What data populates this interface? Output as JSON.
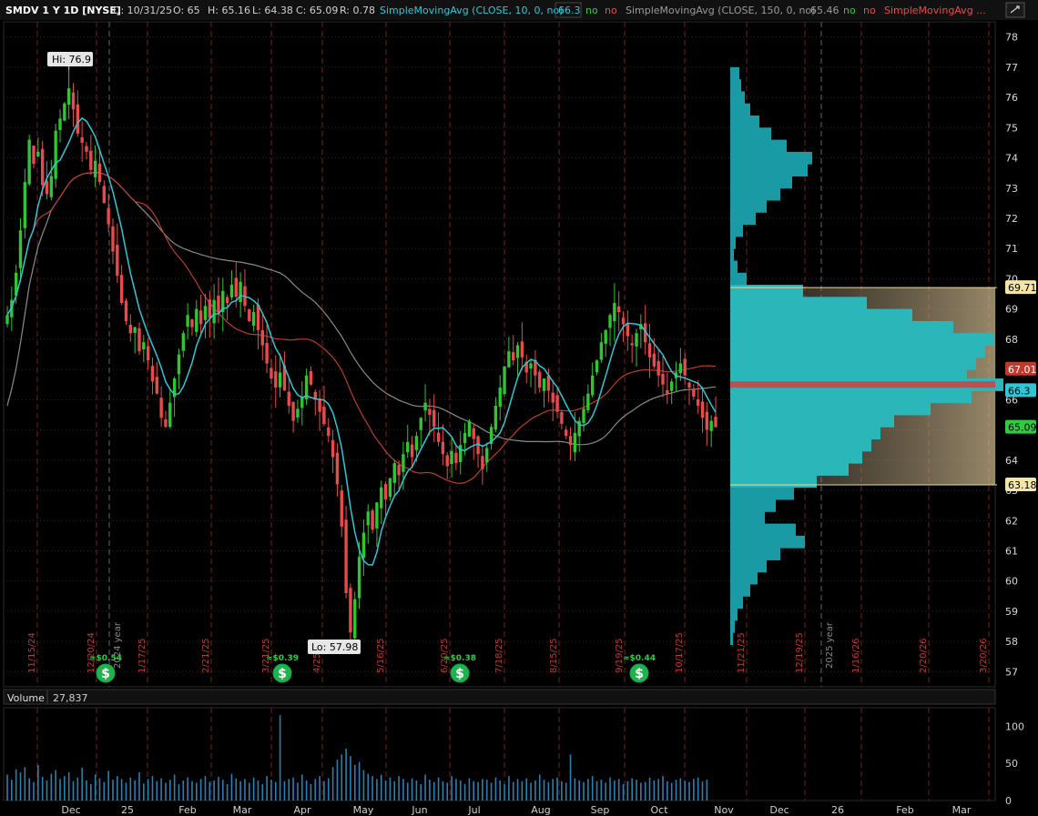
{
  "header": {
    "symbol": "SMDV 1 Y 1D [NYSE]",
    "date": "D: 10/31/25",
    "open": "O: 65",
    "high": "H: 65.16",
    "low": "L: 64.38",
    "close": "C: 65.09",
    "range": "R: 0.78",
    "sma1_label": "SimpleMovingAvg (CLOSE, 10, 0, no)",
    "sma1_value": "66.3",
    "sma1_no1": "no",
    "sma1_no2": "no",
    "sma2_label": "SimpleMovingAvg (CLOSE, 150, 0, no)",
    "sma2_value": "65.46",
    "sma2_no1": "no",
    "sma2_no2": "no",
    "sma3_label": "SimpleMovingAvg ...",
    "settings_icon": "settings-icon"
  },
  "volume_panel": {
    "label": "Volume",
    "value": "27,837"
  },
  "annotations": {
    "hi": "Hi: 76.9",
    "lo": "Lo: 57.98"
  },
  "price_flags": {
    "vp_high": "69.71",
    "sma_red": "67.01",
    "sma_cyan": "66.3",
    "last": "65.09",
    "vp_low": "63.18"
  },
  "dividends": [
    "$0.54",
    "$0.39",
    "$0.38",
    "$0.44"
  ],
  "period_dates": [
    "11/15/24",
    "12/20/24",
    "1/17/25",
    "2/21/25",
    "3/21/25",
    "4/25",
    "5/16/25",
    "6/20/25",
    "7/18/25",
    "8/15/25",
    "9/19/25",
    "10/17/25",
    "11/21/25",
    "12/19/25",
    "1/16/26",
    "2/20/26",
    "3/20/26"
  ],
  "year_markers": [
    "2024 year",
    "2025 year"
  ],
  "colors": {
    "up": "#2fc62f",
    "down": "#e84b4b",
    "sma10": "#2ec7d8",
    "sma_red": "#c0392b",
    "sma150": "#8a8a8a",
    "profile": "#1aa6b0",
    "value_area": "#8a7a62"
  },
  "chart_data": {
    "type": "candlestick",
    "ylim": [
      56.5,
      78.5
    ],
    "yticks": [
      57,
      58,
      59,
      60,
      61,
      62,
      63,
      64,
      65,
      66,
      67,
      68,
      69,
      70,
      71,
      72,
      73,
      74,
      75,
      76,
      77,
      78
    ],
    "x_month_labels": [
      "Dec",
      "25",
      "Feb",
      "Mar",
      "Apr",
      "May",
      "Jun",
      "Jul",
      "Aug",
      "Sep",
      "Oct",
      "Nov",
      "Dec",
      "26",
      "Feb",
      "Mar"
    ],
    "volume_yticks": [
      0,
      50,
      100
    ],
    "volume_ylim": [
      0,
      125
    ],
    "closes": [
      68.8,
      69.3,
      70.2,
      71.6,
      73.2,
      74.6,
      73.8,
      74.2,
      73.1,
      72.8,
      73.4,
      74.9,
      75.3,
      75.8,
      76.3,
      75.6,
      74.8,
      74.5,
      74.2,
      73.6,
      73.9,
      73.2,
      72.5,
      71.8,
      70.9,
      70.1,
      69.2,
      68.6,
      68.2,
      68.4,
      67.6,
      67.9,
      67.3,
      66.6,
      66.2,
      65.4,
      65.1,
      65.9,
      66.7,
      67.5,
      68.2,
      68.8,
      68.4,
      69.0,
      68.5,
      69.1,
      68.7,
      69.3,
      68.9,
      69.6,
      69.2,
      69.8,
      69.4,
      69.9,
      69.1,
      68.6,
      68.9,
      68.3,
      67.8,
      67.2,
      66.7,
      66.4,
      66.9,
      66.3,
      65.8,
      65.3,
      65.7,
      66.1,
      66.8,
      66.5,
      66.0,
      65.6,
      65.2,
      64.8,
      64.1,
      63.2,
      61.8,
      59.6,
      58.3,
      59.4,
      60.8,
      61.6,
      62.3,
      61.7,
      62.6,
      63.1,
      62.7,
      63.4,
      63.9,
      63.5,
      64.2,
      64.6,
      64.1,
      64.8,
      65.4,
      65.9,
      65.5,
      65.1,
      64.6,
      64.2,
      63.8,
      64.3,
      63.9,
      64.5,
      64.9,
      65.3,
      64.7,
      64.2,
      63.7,
      64.4,
      65.1,
      65.8,
      66.4,
      67.1,
      67.6,
      67.3,
      67.8,
      67.4,
      66.9,
      67.2,
      66.8,
      66.4,
      66.7,
      66.3,
      65.9,
      65.6,
      65.2,
      64.8,
      64.5,
      64.9,
      65.3,
      65.7,
      66.2,
      66.8,
      67.3,
      67.9,
      68.3,
      68.8,
      69.2,
      68.9,
      68.5,
      68.1,
      67.8,
      68.2,
      68.5,
      67.9,
      67.4,
      67.1,
      66.8,
      66.5,
      66.2,
      66.6,
      66.9,
      67.2,
      66.8,
      66.4,
      66.1,
      65.8,
      65.4,
      65.0,
      65.3,
      65.09
    ],
    "volumes": [
      35,
      28,
      42,
      38,
      45,
      30,
      25,
      48,
      32,
      27,
      36,
      41,
      29,
      33,
      38,
      26,
      31,
      44,
      27,
      22,
      35,
      30,
      25,
      40,
      28,
      33,
      29,
      24,
      31,
      27,
      38,
      23,
      29,
      33,
      26,
      30,
      24,
      28,
      35,
      22,
      27,
      31,
      26,
      24,
      29,
      33,
      25,
      27,
      32,
      28,
      22,
      36,
      30,
      26,
      29,
      24,
      31,
      27,
      22,
      33,
      28,
      25,
      115,
      26,
      29,
      31,
      24,
      35,
      27,
      22,
      29,
      33,
      26,
      30,
      45,
      55,
      62,
      70,
      60,
      48,
      52,
      41,
      36,
      33,
      29,
      35,
      27,
      31,
      26,
      33,
      29,
      24,
      30,
      27,
      22,
      35,
      28,
      25,
      31,
      26,
      24,
      33,
      29,
      27,
      22,
      30,
      26,
      25,
      29,
      28,
      24,
      31,
      27,
      22,
      33,
      25,
      29,
      26,
      30,
      24,
      27,
      35,
      28,
      25,
      29,
      31,
      26,
      24,
      62,
      30,
      27,
      25,
      29,
      33,
      26,
      28,
      24,
      31,
      27,
      29,
      22,
      26,
      30,
      28,
      24,
      25,
      31,
      27,
      29,
      33,
      26,
      24,
      28,
      30,
      27,
      25,
      29,
      31,
      26,
      28
    ],
    "volume_profile": [
      {
        "price": 76.8,
        "w": 10
      },
      {
        "price": 76.4,
        "w": 12
      },
      {
        "price": 76.0,
        "w": 16
      },
      {
        "price": 75.6,
        "w": 22
      },
      {
        "price": 75.2,
        "w": 32
      },
      {
        "price": 74.8,
        "w": 45
      },
      {
        "price": 74.4,
        "w": 62
      },
      {
        "price": 74.0,
        "w": 90
      },
      {
        "price": 73.6,
        "w": 85
      },
      {
        "price": 73.2,
        "w": 68
      },
      {
        "price": 72.8,
        "w": 55
      },
      {
        "price": 72.4,
        "w": 40
      },
      {
        "price": 72.0,
        "w": 28
      },
      {
        "price": 71.6,
        "w": 14
      },
      {
        "price": 71.2,
        "w": 6
      },
      {
        "price": 70.8,
        "w": 4
      },
      {
        "price": 70.4,
        "w": 8
      },
      {
        "price": 70.0,
        "w": 18
      },
      {
        "price": 69.6,
        "w": 80
      },
      {
        "price": 69.2,
        "w": 150
      },
      {
        "price": 68.8,
        "w": 200
      },
      {
        "price": 68.4,
        "w": 245
      },
      {
        "price": 68.0,
        "w": 290
      },
      {
        "price": 67.6,
        "w": 280
      },
      {
        "price": 67.2,
        "w": 270
      },
      {
        "price": 66.8,
        "w": 260
      },
      {
        "price": 66.5,
        "w": 300
      },
      {
        "price": 66.1,
        "w": 265
      },
      {
        "price": 65.7,
        "w": 220
      },
      {
        "price": 65.3,
        "w": 180
      },
      {
        "price": 64.9,
        "w": 165
      },
      {
        "price": 64.5,
        "w": 155
      },
      {
        "price": 64.1,
        "w": 145
      },
      {
        "price": 63.7,
        "w": 130
      },
      {
        "price": 63.3,
        "w": 95
      },
      {
        "price": 62.9,
        "w": 70
      },
      {
        "price": 62.5,
        "w": 50
      },
      {
        "price": 62.1,
        "w": 38
      },
      {
        "price": 61.7,
        "w": 72
      },
      {
        "price": 61.3,
        "w": 82
      },
      {
        "price": 60.9,
        "w": 55
      },
      {
        "price": 60.5,
        "w": 40
      },
      {
        "price": 60.1,
        "w": 30
      },
      {
        "price": 59.7,
        "w": 22
      },
      {
        "price": 59.3,
        "w": 14
      },
      {
        "price": 58.9,
        "w": 8
      },
      {
        "price": 58.5,
        "w": 5
      },
      {
        "price": 58.1,
        "w": 3
      }
    ]
  }
}
